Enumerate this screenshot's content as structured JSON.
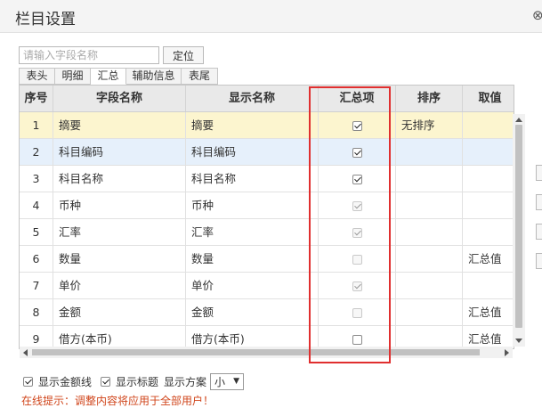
{
  "dialog": {
    "title": "栏目设置"
  },
  "search": {
    "placeholder": "请输入字段名称",
    "locate_label": "定位"
  },
  "tabs": [
    "表头",
    "明细",
    "汇总",
    "辅助信息",
    "表尾"
  ],
  "active_tab": "汇总",
  "table": {
    "headers": [
      "序号",
      "字段名称",
      "显示名称",
      "汇总项",
      "排序",
      "取值"
    ],
    "rows": [
      {
        "seq": "1",
        "field": "摘要",
        "display": "摘要",
        "summary_checked": true,
        "summary_enabled": true,
        "sort": "无排序",
        "value": ""
      },
      {
        "seq": "2",
        "field": "科目编码",
        "display": "科目编码",
        "summary_checked": true,
        "summary_enabled": true,
        "sort": "",
        "value": ""
      },
      {
        "seq": "3",
        "field": "科目名称",
        "display": "科目名称",
        "summary_checked": true,
        "summary_enabled": true,
        "sort": "",
        "value": ""
      },
      {
        "seq": "4",
        "field": "币种",
        "display": "币种",
        "summary_checked": true,
        "summary_enabled": false,
        "sort": "",
        "value": ""
      },
      {
        "seq": "5",
        "field": "汇率",
        "display": "汇率",
        "summary_checked": true,
        "summary_enabled": false,
        "sort": "",
        "value": ""
      },
      {
        "seq": "6",
        "field": "数量",
        "display": "数量",
        "summary_checked": false,
        "summary_enabled": false,
        "sort": "",
        "value": "汇总值"
      },
      {
        "seq": "7",
        "field": "单价",
        "display": "单价",
        "summary_checked": true,
        "summary_enabled": false,
        "sort": "",
        "value": ""
      },
      {
        "seq": "8",
        "field": "金额",
        "display": "金额",
        "summary_checked": false,
        "summary_enabled": false,
        "sort": "",
        "value": "汇总值"
      },
      {
        "seq": "9",
        "field": "借方(本币)",
        "display": "借方(本币)",
        "summary_checked": false,
        "summary_enabled": true,
        "sort": "",
        "value": "汇总值"
      }
    ]
  },
  "footer": {
    "show_amount_line_label": "显示金额线",
    "show_amount_line": true,
    "show_title_label": "显示标题",
    "show_title": true,
    "scheme_label": "显示方案",
    "scheme_value": "小"
  },
  "hint": "在线提示：调整内容将应用于全部用户！"
}
